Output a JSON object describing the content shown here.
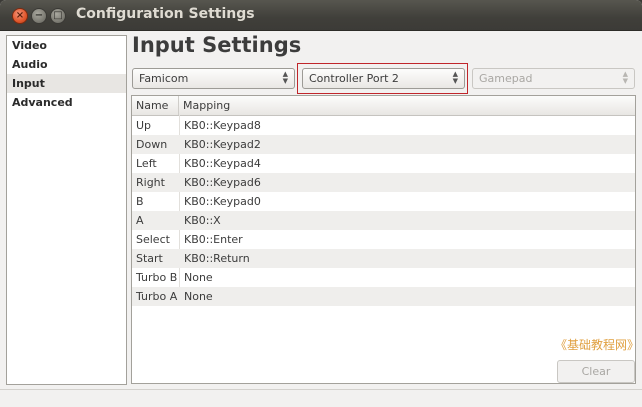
{
  "window": {
    "title": "Configuration Settings"
  },
  "sidebar": {
    "items": [
      {
        "label": "Video",
        "selected": false
      },
      {
        "label": "Audio",
        "selected": false
      },
      {
        "label": "Input",
        "selected": true
      },
      {
        "label": "Advanced",
        "selected": false
      }
    ]
  },
  "main": {
    "title": "Input Settings",
    "system_select": {
      "value": "Famicom"
    },
    "port_select": {
      "value": "Controller Port 2"
    },
    "device_select": {
      "value": "Gamepad",
      "disabled": true
    },
    "table": {
      "columns": [
        "Name",
        "Mapping"
      ],
      "rows": [
        {
          "name": "Up",
          "mapping": "KB0::Keypad8"
        },
        {
          "name": "Down",
          "mapping": "KB0::Keypad2"
        },
        {
          "name": "Left",
          "mapping": "KB0::Keypad4"
        },
        {
          "name": "Right",
          "mapping": "KB0::Keypad6"
        },
        {
          "name": "B",
          "mapping": "KB0::Keypad0"
        },
        {
          "name": "A",
          "mapping": "KB0::X"
        },
        {
          "name": "Select",
          "mapping": "KB0::Enter"
        },
        {
          "name": "Start",
          "mapping": "KB0::Return"
        },
        {
          "name": "Turbo B",
          "mapping": "None"
        },
        {
          "name": "Turbo A",
          "mapping": "None"
        }
      ]
    },
    "clear_label": "Clear",
    "watermark": "《基础教程网》"
  },
  "colors": {
    "highlight": "#c0262b",
    "watermark": "#e0a040"
  }
}
